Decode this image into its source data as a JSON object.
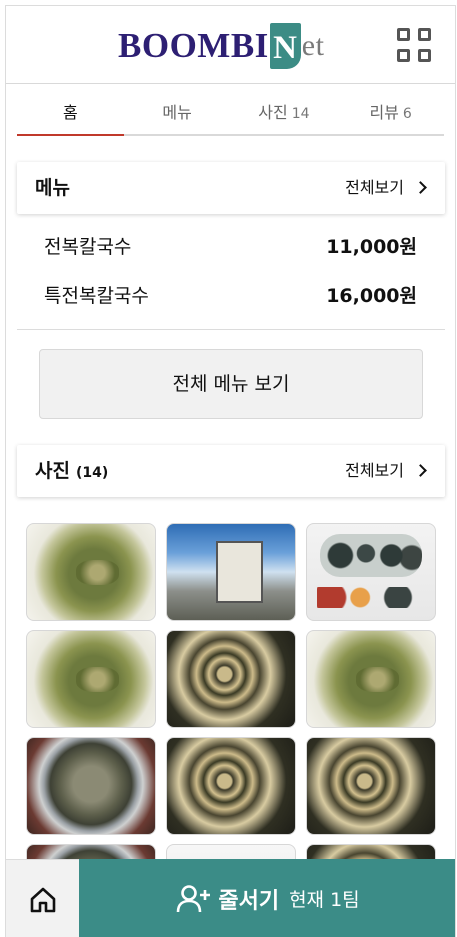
{
  "header": {
    "logo": {
      "part1": "BOOMBI",
      "part2": "N",
      "part3": "et"
    },
    "menu_icon": "grid-icon"
  },
  "tabs": [
    {
      "label": "홈",
      "count": "",
      "active": true
    },
    {
      "label": "메뉴",
      "count": "",
      "active": false
    },
    {
      "label": "사진",
      "count": "14",
      "active": false
    },
    {
      "label": "리뷰",
      "count": "6",
      "active": false
    }
  ],
  "menu_section": {
    "title": "메뉴",
    "more_label": "전체보기",
    "items": [
      {
        "name": "전복칼국수",
        "price": "11,000원"
      },
      {
        "name": "특전복칼국수",
        "price": "16,000원"
      }
    ],
    "full_menu_button": "전체 메뉴 보기"
  },
  "photo_section": {
    "title": "사진",
    "count": "(14)",
    "more_label": "전체보기",
    "photos": [
      {
        "alt": "soup"
      },
      {
        "alt": "sign"
      },
      {
        "alt": "abalone"
      },
      {
        "alt": "soup"
      },
      {
        "alt": "noodle"
      },
      {
        "alt": "soup"
      },
      {
        "alt": "bowl"
      },
      {
        "alt": "noodle"
      },
      {
        "alt": "noodle"
      },
      {
        "alt": "bowl"
      },
      {
        "alt": "snow"
      },
      {
        "alt": "noodle"
      }
    ]
  },
  "bottom_bar": {
    "home_icon": "home-icon",
    "queue_icon": "person-add-icon",
    "queue_label": "줄서기",
    "queue_status": "현재 1팀"
  },
  "colors": {
    "accent": "#3b8c87",
    "tab_indicator": "#c0392b",
    "logo_dark": "#2d1f73"
  }
}
